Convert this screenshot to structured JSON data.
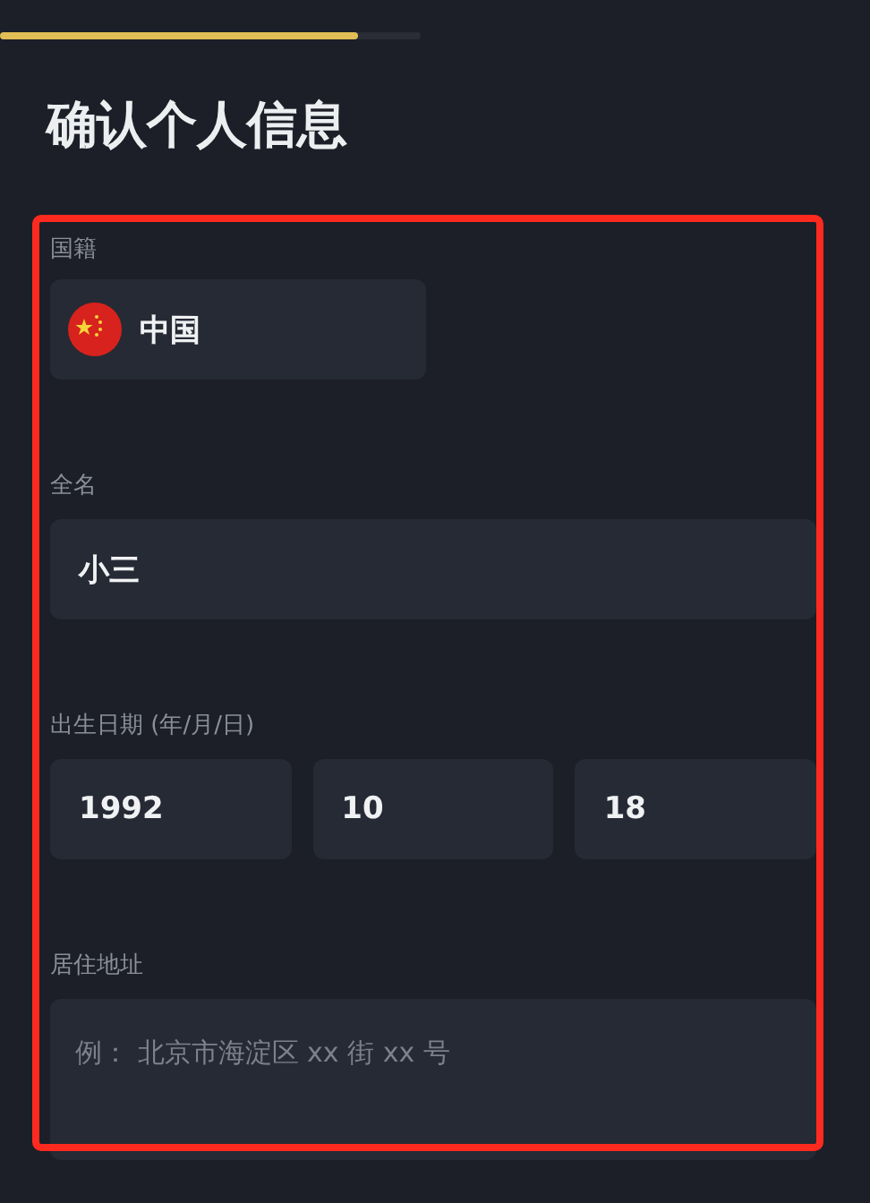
{
  "progress": {
    "level": 0.85
  },
  "title": "确认个人信息",
  "form": {
    "nationality": {
      "label": "国籍",
      "value": "中国"
    },
    "full_name": {
      "label": "全名",
      "value": "小三"
    },
    "birth_date": {
      "label": "出生日期 (年/月/日)",
      "parts": [
        "1992",
        "10",
        "18"
      ]
    },
    "address": {
      "label": "居住地址",
      "placeholder": "例： 北京市海淀区 xx 街 xx 号"
    }
  },
  "highlight": {
    "color": "#ff2a1f"
  }
}
